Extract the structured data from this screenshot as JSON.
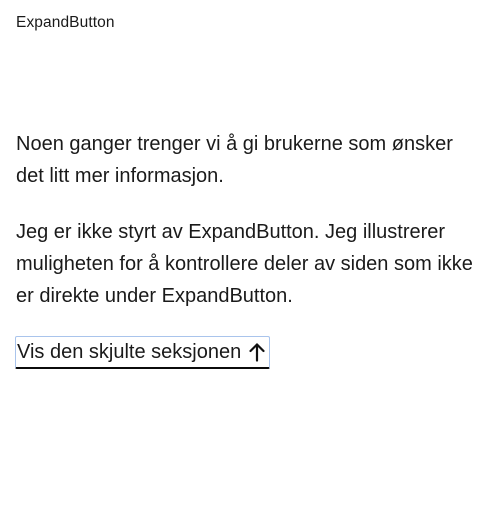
{
  "header": {
    "component_name": "ExpandButton"
  },
  "content": {
    "paragraph_1": "Noen ganger trenger vi å gi brukerne som ønsker det litt mer informasjon.",
    "paragraph_2": "Jeg er ikke styrt av ExpandButton. Jeg illustrerer muligheten for å kontrollere deler av siden som ikke er direkte under ExpandButton."
  },
  "expand_button": {
    "label": "Vis den skjulte seksjonen",
    "icon": "arrow-up-icon",
    "expanded": true,
    "focus_ring_color": "#a9c4ec",
    "underline_color": "#0b0b0b"
  }
}
